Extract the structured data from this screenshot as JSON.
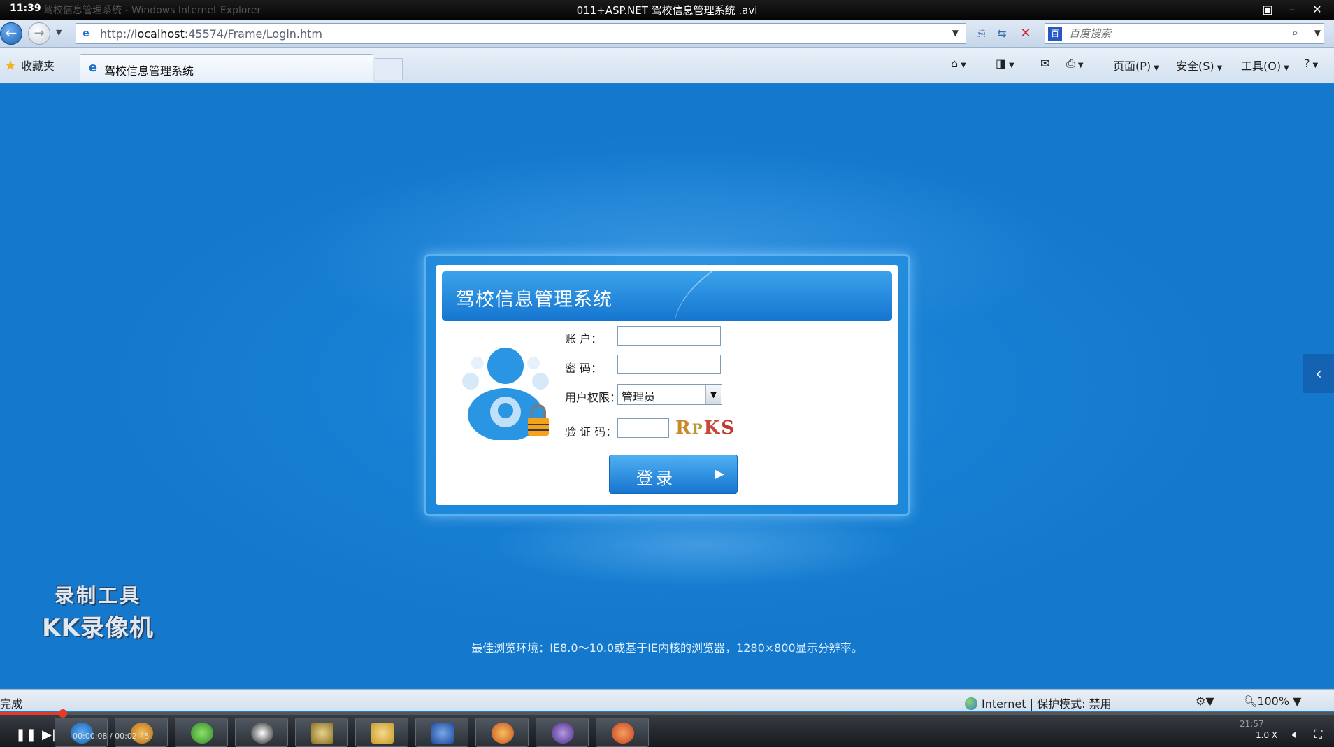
{
  "player": {
    "clock": "11:39",
    "ghost_title": "驾校信息管理系统 - Windows Internet Explorer",
    "title": "011+ASP.NET 驾校信息管理系统 .avi",
    "time": "00:00:08 / 00:02:45",
    "speed": "1.0 X",
    "progress_fraction": 0.05,
    "clock_tray": "21:57"
  },
  "browser": {
    "url_prefix": "http://",
    "url_host": "localhost",
    "url_rest": ":45574/Frame/Login.htm",
    "search_placeholder": "百度搜索",
    "favorites": "收藏夹",
    "tab_title": "驾校信息管理系统",
    "menu": {
      "page": "页面(P)",
      "safety": "安全(S)",
      "tools": "工具(O)"
    },
    "status_left": "完成",
    "status_zone": "Internet | 保护模式: 禁用",
    "zoom": "100%"
  },
  "login": {
    "title": "驾校信息管理系统",
    "account_label": "账    户：",
    "password_label": "密    码：",
    "role_label": "用户权限：",
    "role_value": "管理员",
    "captcha_label": "验 证 码：",
    "captcha_text": "RPKS",
    "login_button": "登录"
  },
  "footer_note": "最佳浏览环境：IE8.0～10.0或基于IE内核的浏览器，1280×800显示分辨率。",
  "watermark": {
    "line1": "录制工具",
    "line2": "KK录像机"
  },
  "colors": {
    "background": "#1780d3",
    "panel_header": "#1575cf",
    "progress": "#e23b2b"
  }
}
